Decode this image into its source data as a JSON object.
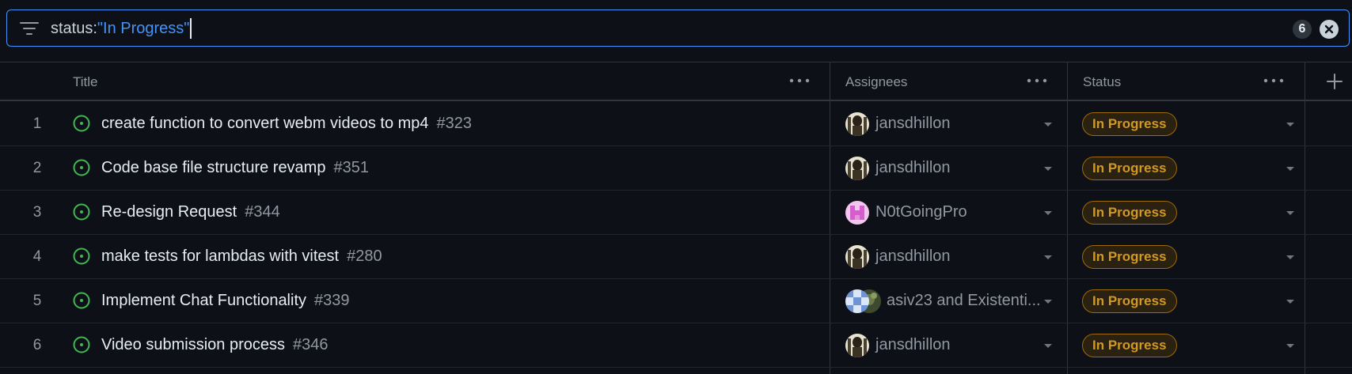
{
  "filter": {
    "key": "status:",
    "value": "\"In Progress\"",
    "count": "6"
  },
  "columns": {
    "title": "Title",
    "assignees": "Assignees",
    "status": "Status"
  },
  "rows": [
    {
      "num": "1",
      "title": "create function to convert webm videos to mp4",
      "issue": "#323",
      "assignee": "jansdhillon",
      "status": "In Progress"
    },
    {
      "num": "2",
      "title": "Code base file structure revamp",
      "issue": "#351",
      "assignee": "jansdhillon",
      "status": "In Progress"
    },
    {
      "num": "3",
      "title": "Re-design Request",
      "issue": "#344",
      "assignee": "N0tGoingPro",
      "status": "In Progress"
    },
    {
      "num": "4",
      "title": "make tests for lambdas with vitest",
      "issue": "#280",
      "assignee": "jansdhillon",
      "status": "In Progress"
    },
    {
      "num": "5",
      "title": "Implement Chat Functionality",
      "issue": "#339",
      "assignee": "asiv23 and Existenti...",
      "status": "In Progress"
    },
    {
      "num": "6",
      "title": "Video submission process",
      "issue": "#346",
      "assignee": "jansdhillon",
      "status": "In Progress"
    }
  ],
  "colors": {
    "background": "#0d1117",
    "accent": "#4493f8",
    "open_issue": "#3fb950",
    "in_progress": "#d29922"
  }
}
